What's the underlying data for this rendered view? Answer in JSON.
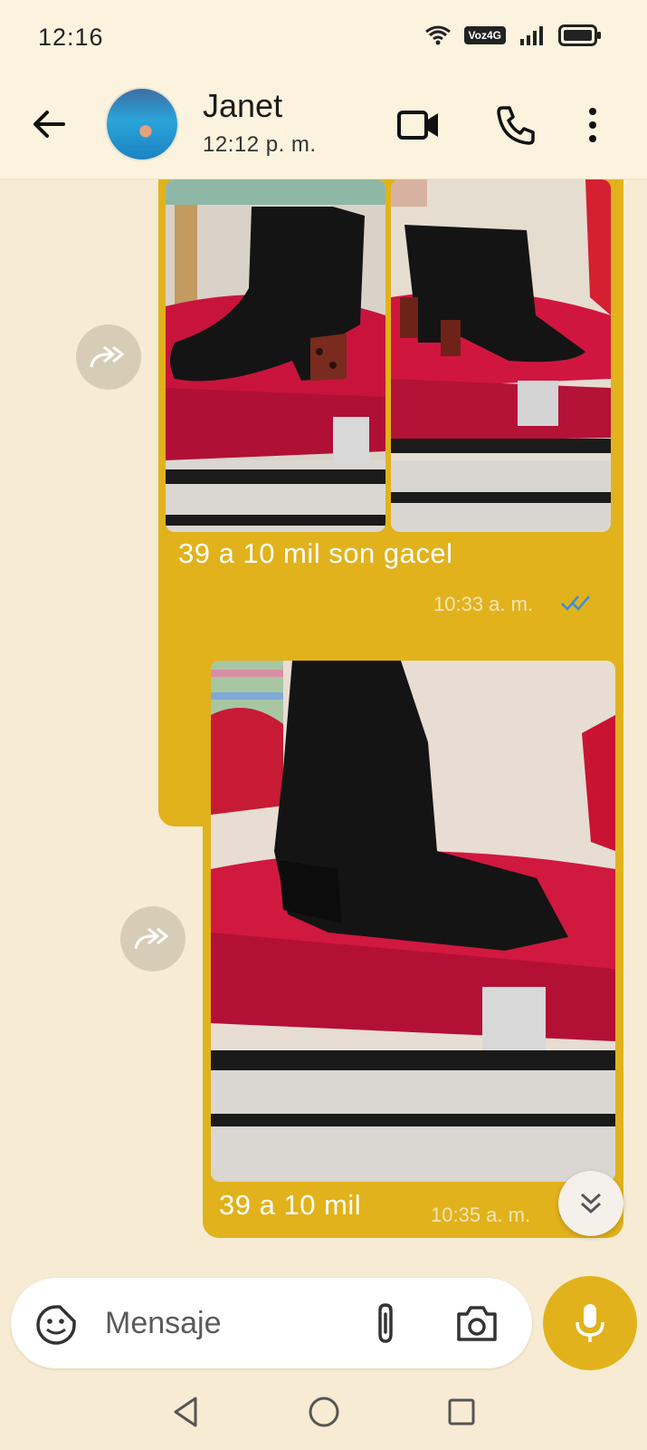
{
  "status_bar": {
    "time": "12:16",
    "network_badge": "Voz4G",
    "icons": [
      "wifi-icon",
      "signal-icon",
      "battery-icon"
    ]
  },
  "header": {
    "contact_name": "Janet",
    "last_seen": "12:12 p. m.",
    "icons": [
      "back-arrow-icon",
      "video-call-icon",
      "phone-icon",
      "more-vert-icon"
    ]
  },
  "messages": [
    {
      "type": "image-album",
      "images": [
        "black ankle boots with leopard heel on red chair",
        "black ankle boots side view on red chair"
      ],
      "caption": "39 a 10 mil son gacel",
      "time": "10:33 a. m.",
      "status": "read"
    },
    {
      "type": "image",
      "images": [
        "black suede western boots on red chair"
      ],
      "caption": "39 a 10 mil",
      "time": "10:35 a. m.",
      "status": "read"
    }
  ],
  "composer": {
    "placeholder": "Mensaje",
    "icons": [
      "emoji-sticker-icon",
      "attach-clip-icon",
      "camera-icon",
      "mic-icon"
    ]
  },
  "colors": {
    "accent": "#e1b21c",
    "wallpaper": "#f7ecd3",
    "tick_read": "#3b8fd9"
  }
}
